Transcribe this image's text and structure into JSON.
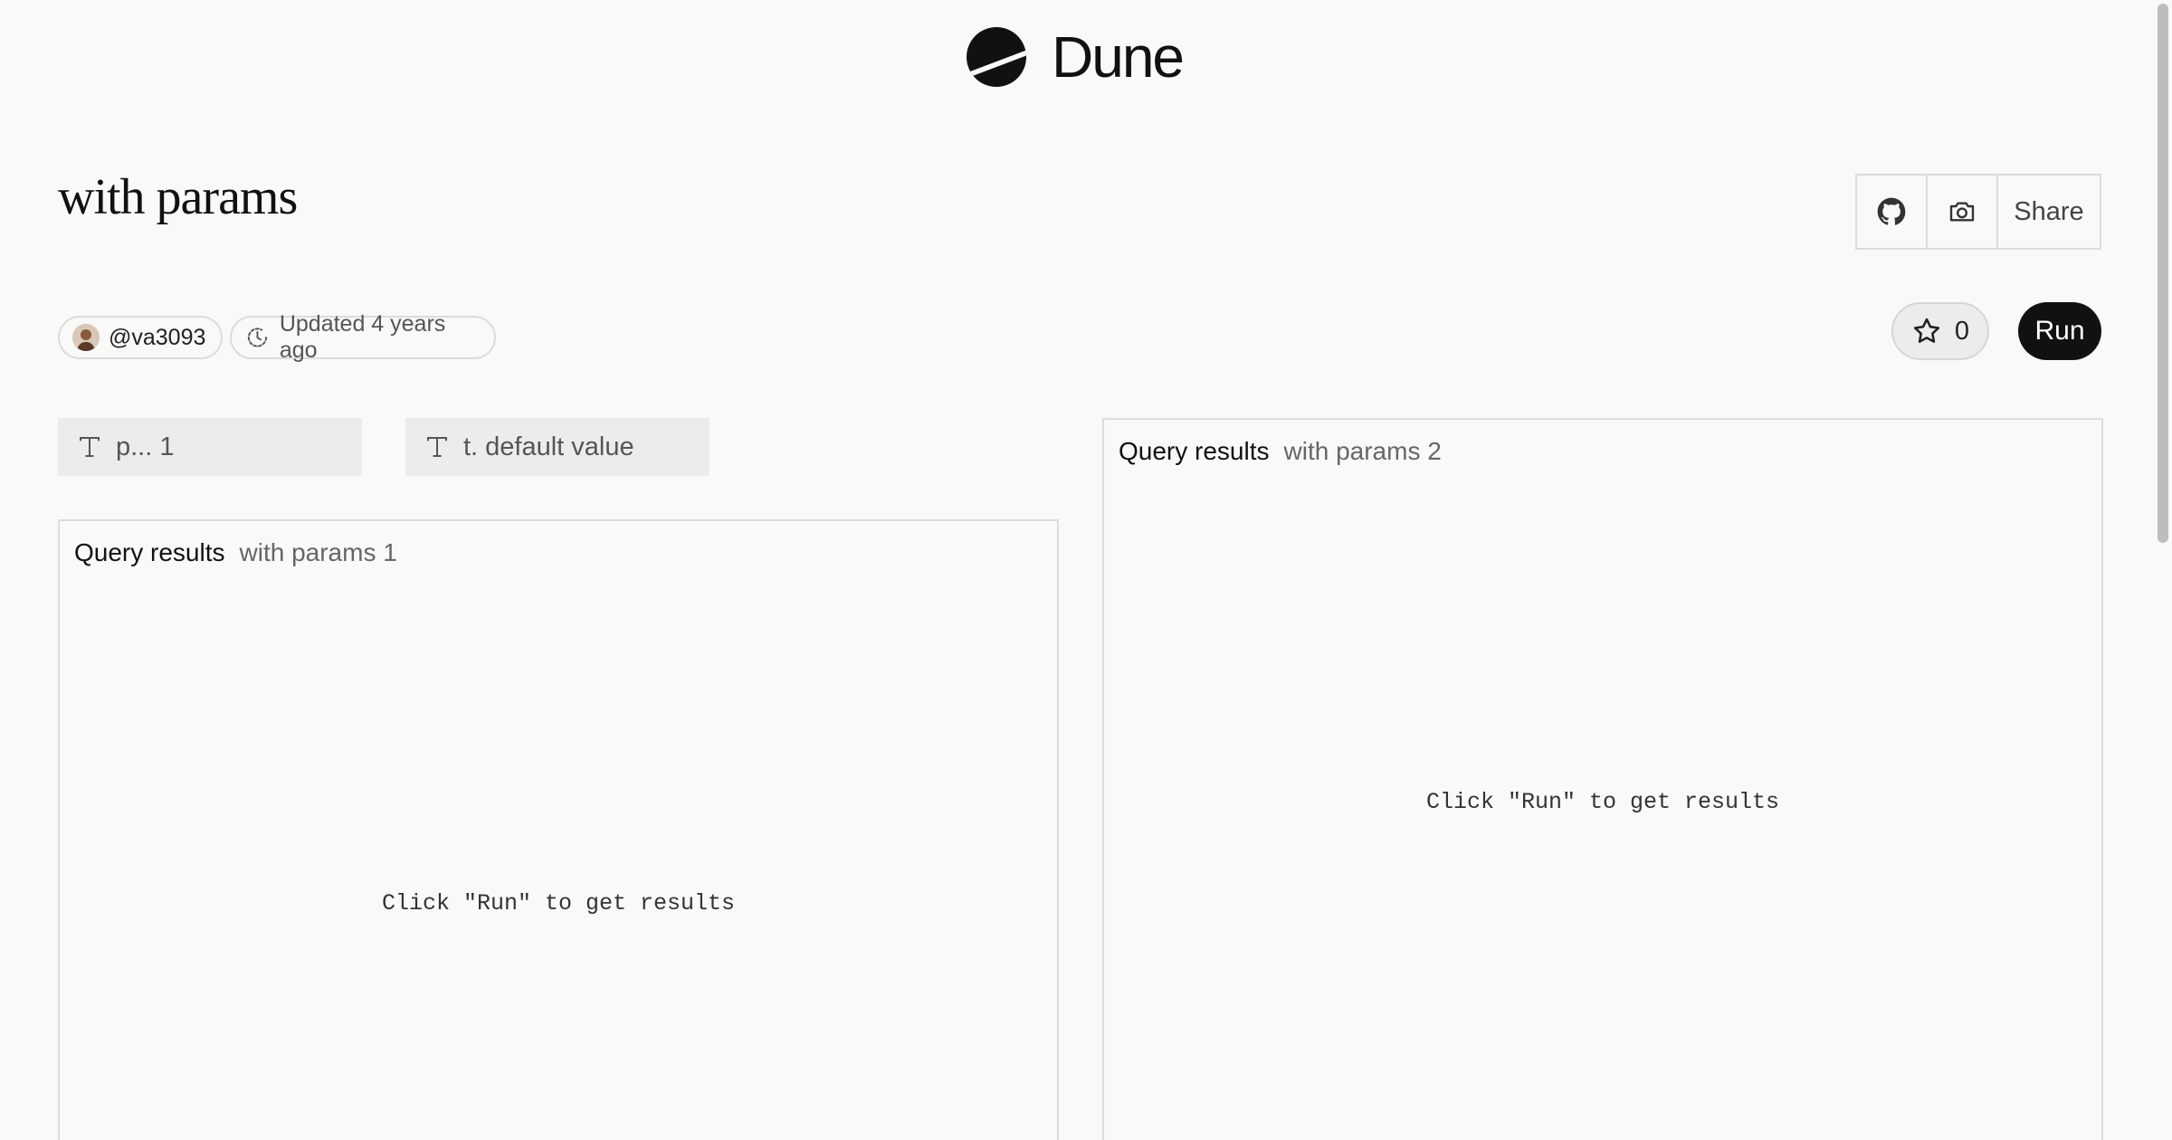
{
  "header": {
    "brand": "Dune",
    "logo_icon": "dune-logo-icon"
  },
  "query": {
    "title": "with params"
  },
  "actions": {
    "github_icon": "github-icon",
    "screenshot_icon": "camera-icon",
    "share_label": "Share"
  },
  "meta": {
    "author": "@va3093",
    "updated": "Updated 4 years ago",
    "updated_icon": "clock-icon"
  },
  "controls": {
    "star_count": "0",
    "run_label": "Run"
  },
  "params": [
    {
      "icon": "text-type-icon",
      "value": "p... 1"
    },
    {
      "icon": "text-type-icon",
      "value": "t. default value"
    }
  ],
  "panels": [
    {
      "label": "Query results",
      "name": "with params 1",
      "empty": "Click \"Run\" to get results"
    },
    {
      "label": "Query results",
      "name": "with params 2",
      "empty": "Click \"Run\" to get results"
    }
  ],
  "colors": {
    "background": "#f9f9f7",
    "primary": "#111111",
    "border": "#dcdcd9",
    "param_bg": "#ececea"
  }
}
